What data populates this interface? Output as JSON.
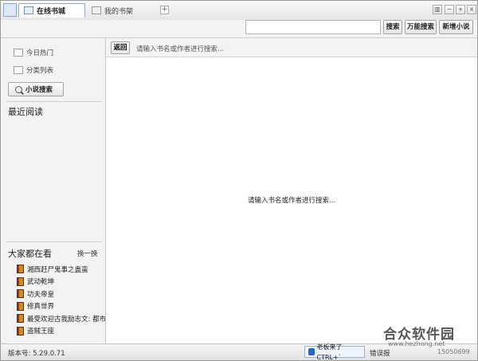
{
  "tabs": [
    {
      "label": "在线书城",
      "active": true
    },
    {
      "label": "我的书架",
      "active": false
    }
  ],
  "add_tab_label": "+",
  "window_controls": {
    "skin": "▥",
    "minimize": "−",
    "maximize": "+",
    "close": "×"
  },
  "toolbar": {
    "search_placeholder": "",
    "search_label": "搜索",
    "power_search_label": "万能搜索",
    "new_novel_label": "新增小说"
  },
  "sidebar": {
    "items": [
      {
        "label": "今日热门",
        "icon": "book-open-icon"
      },
      {
        "label": "分类列表",
        "icon": "list-icon"
      }
    ],
    "search_button_label": "小说搜索",
    "recent_title": "最近阅读",
    "popular_title": "大家都在看",
    "switch_label": "换一换",
    "books": [
      "湘西赶尸鬼事之蛊蛮",
      "武动乾坤",
      "功夫帝皇",
      "修真世界",
      "最受欢迎古我励志文: 都市",
      "盗贼王座"
    ]
  },
  "content": {
    "back_label": "返回",
    "hint_top": "请输入书名或作者进行搜索...",
    "hint_center": "请输入书名或作者进行搜索..."
  },
  "status": {
    "version": "版本号: 5.29.0.71",
    "boss_label": "老板来了CTRL+`",
    "error_report": "错误报",
    "phone": "15050699"
  },
  "watermark": {
    "logo": "合众软件园",
    "url": "www.hezhong.net"
  },
  "colors": {
    "accent": "#2b64c8",
    "window_bg": "#f3f3f3",
    "content_bg": "#ffffff"
  }
}
